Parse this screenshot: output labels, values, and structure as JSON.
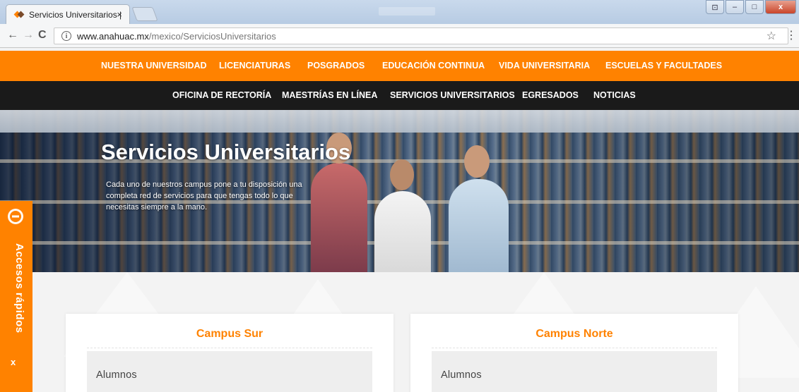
{
  "browser": {
    "tab_title": "Servicios Universitarios |",
    "tab_close": "×",
    "url_host": "www.anahuac.mx",
    "url_path": "/mexico/ServiciosUniversitarios",
    "back": "←",
    "forward": "→",
    "reload": "C",
    "star": "☆",
    "menu": "⋮",
    "info": "i",
    "win_min": "–",
    "win_max": "□",
    "win_close": "x"
  },
  "nav_primary": [
    {
      "label": "NUESTRA UNIVERSIDAD"
    },
    {
      "label": "LICENCIATURAS"
    },
    {
      "label": "POSGRADOS"
    },
    {
      "label": "EDUCACIÓN CONTINUA"
    },
    {
      "label": "VIDA UNIVERSITARIA"
    },
    {
      "label": "ESCUELAS Y FACULTADES"
    }
  ],
  "nav_secondary": [
    {
      "label": "OFICINA DE RECTORÍA"
    },
    {
      "label": "MAESTRÍAS EN LÍNEA"
    },
    {
      "label": "SERVICIOS UNIVERSITARIOS"
    },
    {
      "label": "EGRESADOS"
    },
    {
      "label": "NOTICIAS"
    }
  ],
  "hero": {
    "title": "Servicios Universitarios",
    "description": "Cada uno de nuestros campus pone a tu disposición una completa red de servicios para que tengas todo lo que necesitas siempre a la mano."
  },
  "quick_access": {
    "label": "Accesos rápidos",
    "close": "x"
  },
  "campuses": [
    {
      "title": "Campus Sur",
      "item": "Alumnos"
    },
    {
      "title": "Campus Norte",
      "item": "Alumnos"
    }
  ],
  "colors": {
    "brand_orange": "#ff8200",
    "nav_dark": "#1a1a1a"
  }
}
